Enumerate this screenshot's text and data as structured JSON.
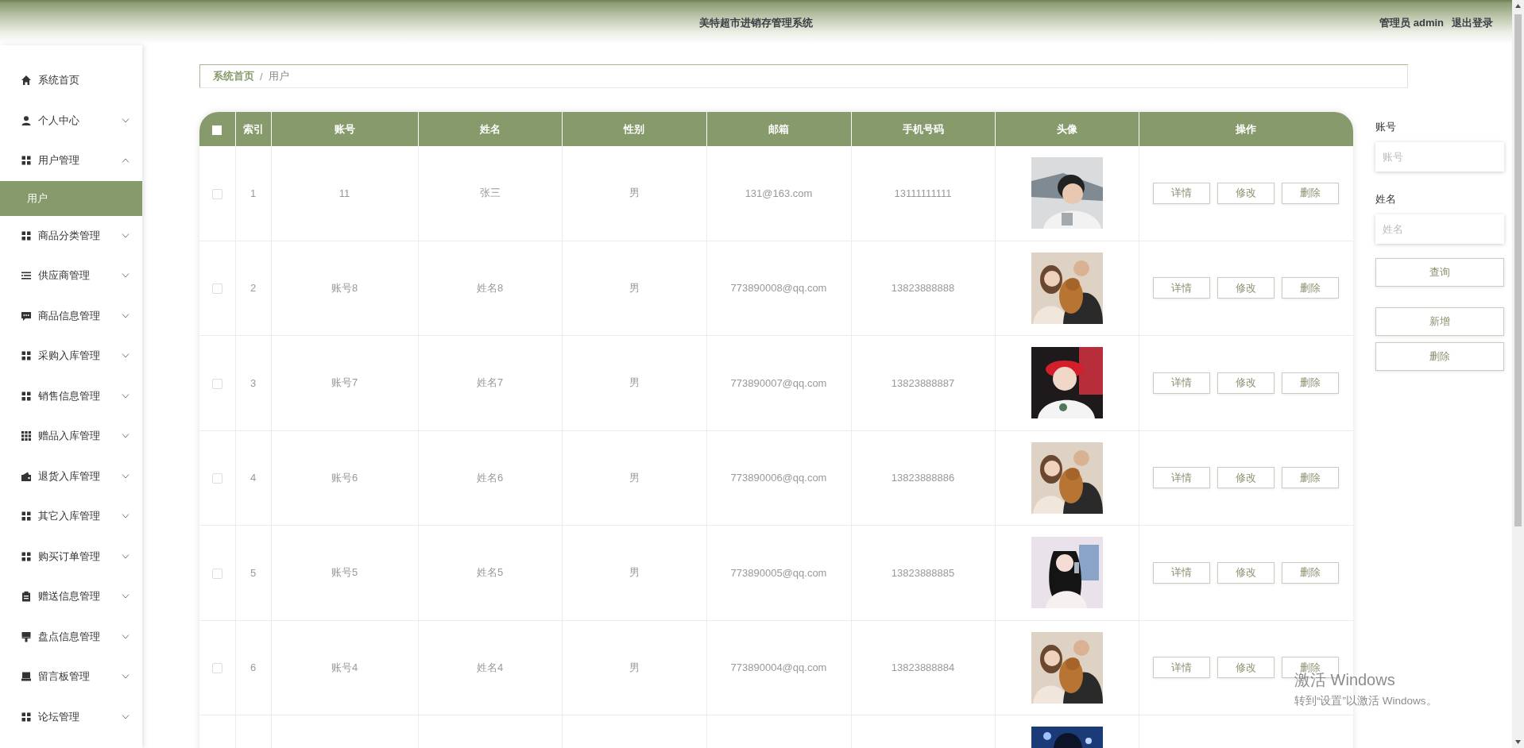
{
  "header": {
    "title": "美特超市进销存管理系统",
    "user_label": "管理员 admin",
    "logout": "退出登录"
  },
  "sidebar": {
    "items": [
      {
        "kind": "link",
        "label": "系统首页"
      },
      {
        "kind": "menu",
        "label": "个人中心",
        "expanded": false
      },
      {
        "kind": "menu",
        "label": "用户管理",
        "expanded": true,
        "children": [
          {
            "label": "用户",
            "selected": true
          }
        ]
      },
      {
        "kind": "menu",
        "label": "商品分类管理",
        "expanded": false
      },
      {
        "kind": "menu",
        "label": "供应商管理",
        "expanded": false
      },
      {
        "kind": "menu",
        "label": "商品信息管理",
        "expanded": false
      },
      {
        "kind": "menu",
        "label": "采购入库管理",
        "expanded": false
      },
      {
        "kind": "menu",
        "label": "销售信息管理",
        "expanded": false
      },
      {
        "kind": "menu",
        "label": "赠品入库管理",
        "expanded": false
      },
      {
        "kind": "menu",
        "label": "退货入库管理",
        "expanded": false
      },
      {
        "kind": "menu",
        "label": "其它入库管理",
        "expanded": false
      },
      {
        "kind": "menu",
        "label": "购买订单管理",
        "expanded": false
      },
      {
        "kind": "menu",
        "label": "赠送信息管理",
        "expanded": false
      },
      {
        "kind": "menu",
        "label": "盘点信息管理",
        "expanded": false
      },
      {
        "kind": "menu",
        "label": "留言板管理",
        "expanded": false
      },
      {
        "kind": "menu",
        "label": "论坛管理",
        "expanded": false
      }
    ]
  },
  "breadcrumb": {
    "items": [
      "系统首页",
      "用户"
    ],
    "separator": "/"
  },
  "table": {
    "columns": [
      {
        "kind": "checkbox",
        "checked": false
      },
      {
        "kind": "text",
        "label": "索引"
      },
      {
        "kind": "text",
        "label": "账号"
      },
      {
        "kind": "text",
        "label": "姓名"
      },
      {
        "kind": "text",
        "label": "性别"
      },
      {
        "kind": "text",
        "label": "邮箱"
      },
      {
        "kind": "text",
        "label": "手机号码"
      },
      {
        "kind": "text",
        "label": "头像"
      },
      {
        "kind": "text",
        "label": "操作"
      }
    ],
    "rows": [
      {
        "checked": false,
        "index": "1",
        "account": "11",
        "name": "张三",
        "gender": "男",
        "email": "131@163.com",
        "phone": "13111111111",
        "avatar": {
          "kind": "picture"
        },
        "actions": [
          "详情",
          "修改",
          "删除"
        ]
      },
      {
        "checked": false,
        "index": "2",
        "account": "账号8",
        "name": "姓名8",
        "gender": "男",
        "email": "773890008@qq.com",
        "phone": "13823888888",
        "avatar": {
          "kind": "picture"
        },
        "actions": [
          "详情",
          "修改",
          "删除"
        ]
      },
      {
        "checked": false,
        "index": "3",
        "account": "账号7",
        "name": "姓名7",
        "gender": "男",
        "email": "773890007@qq.com",
        "phone": "13823888887",
        "avatar": {
          "kind": "picture"
        },
        "actions": [
          "详情",
          "修改",
          "删除"
        ]
      },
      {
        "checked": false,
        "index": "4",
        "account": "账号6",
        "name": "姓名6",
        "gender": "男",
        "email": "773890006@qq.com",
        "phone": "13823888886",
        "avatar": {
          "kind": "picture"
        },
        "actions": [
          "详情",
          "修改",
          "删除"
        ]
      },
      {
        "checked": false,
        "index": "5",
        "account": "账号5",
        "name": "姓名5",
        "gender": "男",
        "email": "773890005@qq.com",
        "phone": "13823888885",
        "avatar": {
          "kind": "picture"
        },
        "actions": [
          "详情",
          "修改",
          "删除"
        ]
      },
      {
        "checked": false,
        "index": "6",
        "account": "账号4",
        "name": "姓名4",
        "gender": "男",
        "email": "773890004@qq.com",
        "phone": "13823888884",
        "avatar": {
          "kind": "picture"
        },
        "actions": [
          "详情",
          "修改",
          "删除"
        ]
      },
      {
        "avatar": {
          "kind": "picture"
        }
      }
    ]
  },
  "search_panel": {
    "fields": [
      {
        "label": "账号",
        "placeholder": "账号"
      },
      {
        "label": "姓名",
        "placeholder": "姓名"
      }
    ],
    "search_button": "查询",
    "buttons": [
      "新增",
      "删除"
    ]
  },
  "activation_notice": {
    "title": "激活 Windows",
    "subtitle": "转到“设置”以激活 Windows。"
  }
}
